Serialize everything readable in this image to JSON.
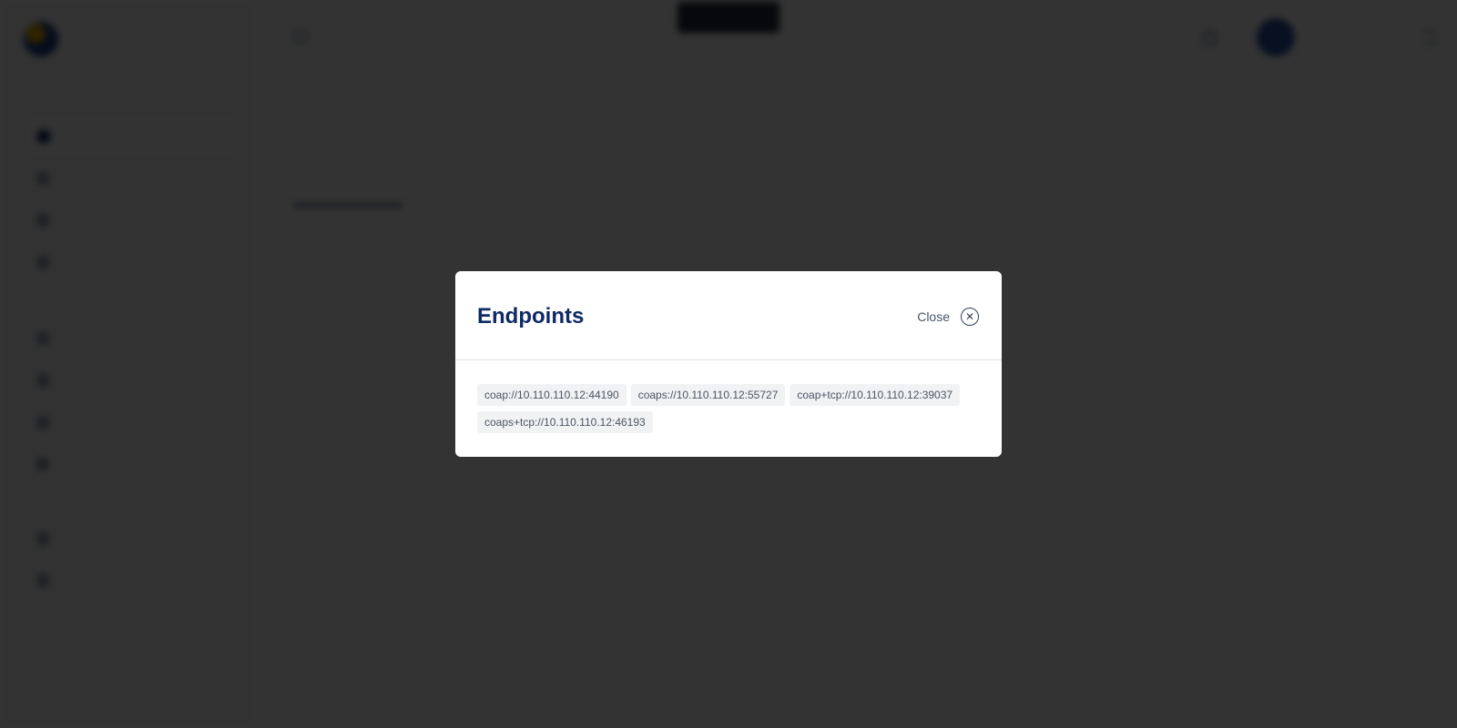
{
  "modal": {
    "title": "Endpoints",
    "close_label": "Close",
    "close_icon": "close-circle-icon",
    "endpoints": [
      "coap://10.110.110.12:44190",
      "coaps://10.110.110.12:55727",
      "coap+tcp://10.110.110.12:39037",
      "coaps+tcp://10.110.110.12:46193"
    ]
  },
  "colors": {
    "overlay": "#000000",
    "modal_background": "#ffffff",
    "title": "#0f2a64",
    "chip_background": "#f1f2f4",
    "chip_text": "#4b5563"
  }
}
